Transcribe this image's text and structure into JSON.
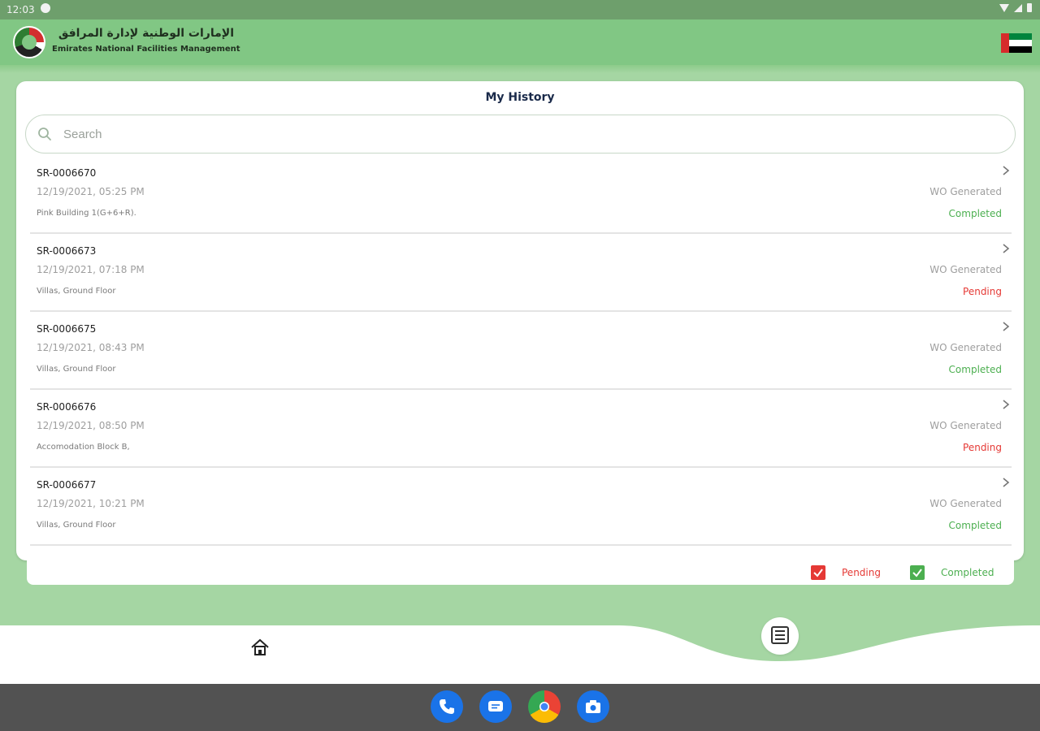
{
  "status_bar": {
    "time": "12:03"
  },
  "header": {
    "logo_arabic": "الإمارات الوطنية لإدارة المرافق",
    "logo_english": "Emirates National Facilities Management",
    "flag_icon": "uae-flag-icon"
  },
  "card": {
    "title": "My History",
    "search_placeholder": "Search",
    "items": [
      {
        "id": "SR-0006670",
        "date": "12/19/2021, 05:25 PM",
        "location": "Pink Building 1(G+6+R).",
        "wo": "WO Generated",
        "status": "Completed",
        "status_color": "#4caf50"
      },
      {
        "id": "SR-0006673",
        "date": "12/19/2021, 07:18 PM",
        "location": "Villas, Ground Floor",
        "wo": "WO Generated",
        "status": "Pending",
        "status_color": "#e53935"
      },
      {
        "id": "SR-0006675",
        "date": "12/19/2021, 08:43 PM",
        "location": "Villas, Ground Floor",
        "wo": "WO Generated",
        "status": "Completed",
        "status_color": "#4caf50"
      },
      {
        "id": "SR-0006676",
        "date": "12/19/2021, 08:50 PM",
        "location": "Accomodation Block B,",
        "wo": "WO Generated",
        "status": "Pending",
        "status_color": "#e53935"
      },
      {
        "id": "SR-0006677",
        "date": "12/19/2021, 10:21 PM",
        "location": "Villas, Ground Floor",
        "wo": "WO Generated",
        "status": "Completed",
        "status_color": "#4caf50"
      }
    ]
  },
  "legend": {
    "pending_label": "Pending",
    "completed_label": "Completed",
    "pending_color": "#e53935",
    "completed_color": "#4caf50"
  },
  "bottom_nav": {
    "home_icon": "home-icon",
    "history_icon": "history-list-icon"
  },
  "system_apps": [
    "phone-icon",
    "messages-icon",
    "chrome-icon",
    "camera-icon"
  ]
}
